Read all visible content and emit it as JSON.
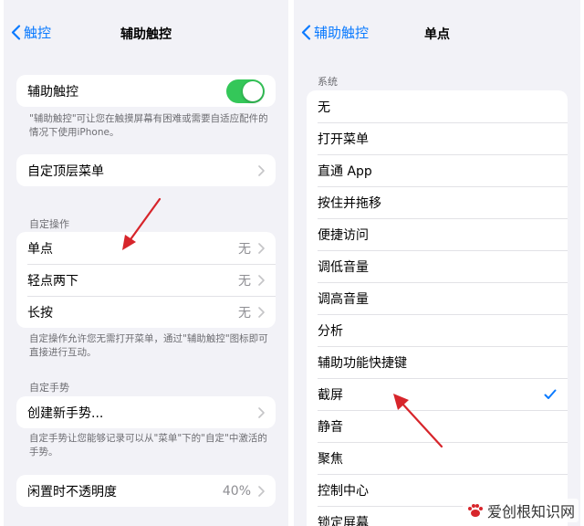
{
  "left": {
    "back_label": "触控",
    "title": "辅助触控",
    "main_toggle": {
      "label": "辅助触控",
      "on": true
    },
    "main_footnote": "\"辅助触控\"可让您在触摸屏幕有困难或需要自适应配件的情况下使用iPhone。",
    "top_menu": {
      "label": "自定顶层菜单"
    },
    "custom_actions": {
      "header": "自定操作",
      "rows": [
        {
          "label": "单点",
          "value": "无"
        },
        {
          "label": "轻点两下",
          "value": "无"
        },
        {
          "label": "长按",
          "value": "无"
        }
      ],
      "footnote": "自定操作允许您无需打开菜单，通过\"辅助触控\"图标即可直接进行互动。"
    },
    "custom_gestures": {
      "header": "自定手势",
      "create_label": "创建新手势...",
      "footnote": "自定手势让您能够记录可以从\"菜单\"下的\"自定\"中激活的手势。"
    },
    "idle_opacity": {
      "label": "闲置时不透明度",
      "value": "40%"
    }
  },
  "right": {
    "back_label": "辅助触控",
    "title": "单点",
    "section_header": "系统",
    "options": [
      {
        "label": "无",
        "selected": false
      },
      {
        "label": "打开菜单",
        "selected": false
      },
      {
        "label": "直通 App",
        "selected": false
      },
      {
        "label": "按住并拖移",
        "selected": false
      },
      {
        "label": "便捷访问",
        "selected": false
      },
      {
        "label": "调低音量",
        "selected": false
      },
      {
        "label": "调高音量",
        "selected": false
      },
      {
        "label": "分析",
        "selected": false
      },
      {
        "label": "辅助功能快捷键",
        "selected": false
      },
      {
        "label": "截屏",
        "selected": true
      },
      {
        "label": "静音",
        "selected": false
      },
      {
        "label": "聚焦",
        "selected": false
      },
      {
        "label": "控制中心",
        "selected": false
      },
      {
        "label": "锁定屏幕",
        "selected": false
      }
    ]
  },
  "watermark": "爱创根知识网",
  "colors": {
    "accent": "#0a7aff",
    "toggle_on": "#34c759",
    "annotation_arrow": "#d7252b"
  }
}
